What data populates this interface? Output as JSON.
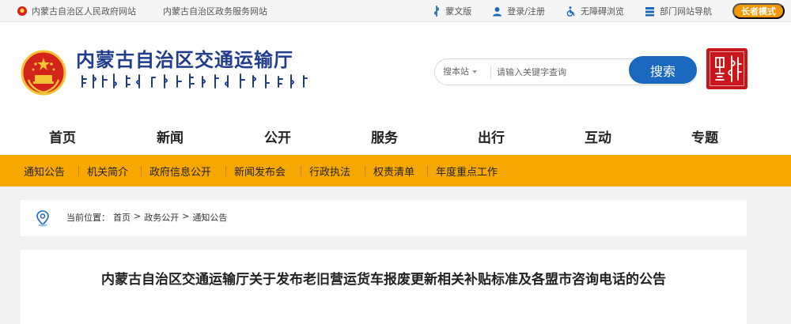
{
  "topbar": {
    "links": [
      "内蒙古自治区人民政府网站",
      "内蒙古自治区政务服务网站"
    ],
    "right_items": [
      {
        "label": "蒙文版",
        "icon": "mongolian-script-icon"
      },
      {
        "label": "登录/注册",
        "icon": "user-icon"
      },
      {
        "label": "无障碍浏览",
        "icon": "accessibility-icon"
      },
      {
        "label": "部门网站导航",
        "icon": "sitemap-icon"
      }
    ],
    "elder_mode": "长者模式"
  },
  "header": {
    "title": "内蒙古自治区交通运输厅",
    "search": {
      "scope": "搜本站",
      "placeholder": "请输入关键字查询",
      "button": "搜索"
    }
  },
  "main_nav": [
    "首页",
    "新闻",
    "公开",
    "服务",
    "出行",
    "互动",
    "专题"
  ],
  "sub_nav": [
    "通知公告",
    "机关简介",
    "政府信息公开",
    "新闻发布会",
    "行政执法",
    "权责清单",
    "年度重点工作"
  ],
  "breadcrumb": {
    "label": "当前位置：",
    "items": [
      "首页",
      ">",
      "政务公开",
      ">",
      "通知公告"
    ]
  },
  "article": {
    "title": "内蒙古自治区交通运输厅关于发布老旧营运货车报废更新相关补贴标准及各盟市咨询电话的公告"
  },
  "colors": {
    "brand_blue": "#1f3d8a",
    "search_button": "#1a68c0",
    "subnav_orange": "#f7a800",
    "elder_button": "#f39800",
    "seal_red": "#c8161d"
  }
}
